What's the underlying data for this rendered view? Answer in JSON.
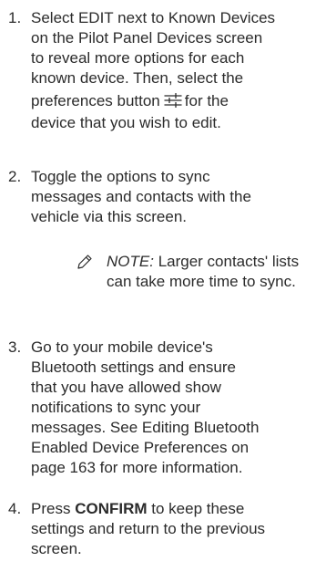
{
  "steps": [
    {
      "number": "1.",
      "lines": [
        "Select EDIT next to Known Devices",
        "on the Pilot Panel Devices screen",
        "to reveal more options for each",
        "known device. Then, select the"
      ],
      "line5_before_icon": "preferences button",
      "line5_after_icon": "for the",
      "line6": "device that you wish to edit.",
      "icon": "preferences-sliders-icon"
    },
    {
      "number": "2.",
      "lines": [
        "Toggle the options to sync",
        "messages and contacts with the",
        "vehicle via this screen."
      ]
    },
    {
      "number": "3.",
      "lines": [
        "Go to your mobile device's",
        "Bluetooth settings and ensure",
        "that you have allowed show",
        "notifications to sync your",
        "messages. See Editing Bluetooth",
        "Enabled Device Preferences on",
        "page 163 for more information."
      ]
    },
    {
      "number": "4.",
      "line1_before_bold": "Press",
      "line1_bold": "CONFIRM",
      "line1_after_bold": "to keep these",
      "lines_rest": [
        "settings and return to the previous",
        "screen."
      ]
    }
  ],
  "note": {
    "icon": "pencil-icon",
    "label": "NOTE:",
    "line1_rest": "Larger contacts' lists",
    "line2": "can take more time to sync."
  }
}
